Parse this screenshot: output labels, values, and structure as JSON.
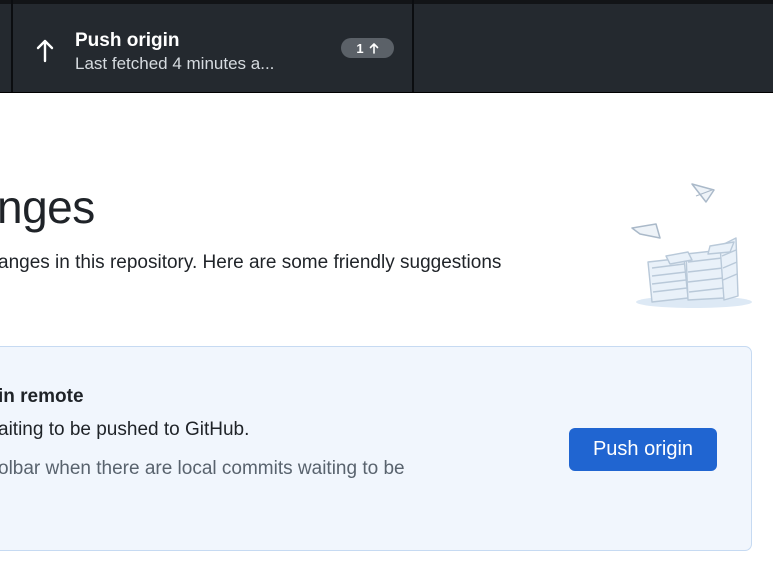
{
  "toolbar": {
    "push": {
      "title": "Push origin",
      "subtitle": "Last fetched 4 minutes a...",
      "ahead_count": "1",
      "icon": "arrow-up-icon"
    }
  },
  "main": {
    "heading": "nges",
    "description": "anges in this repository. Here are some friendly suggestions",
    "illustration": "paper-stacks-illustration",
    "suggestion": {
      "title": "in remote",
      "description": "aiting to be pushed to GitHub.",
      "hint": "olbar when there are local commits waiting to be",
      "button_label": "Push origin"
    }
  },
  "colors": {
    "toolbar_bg": "#24292f",
    "primary_button": "#2065d1",
    "card_bg": "#f1f6fd",
    "card_border": "#c6daf2"
  }
}
